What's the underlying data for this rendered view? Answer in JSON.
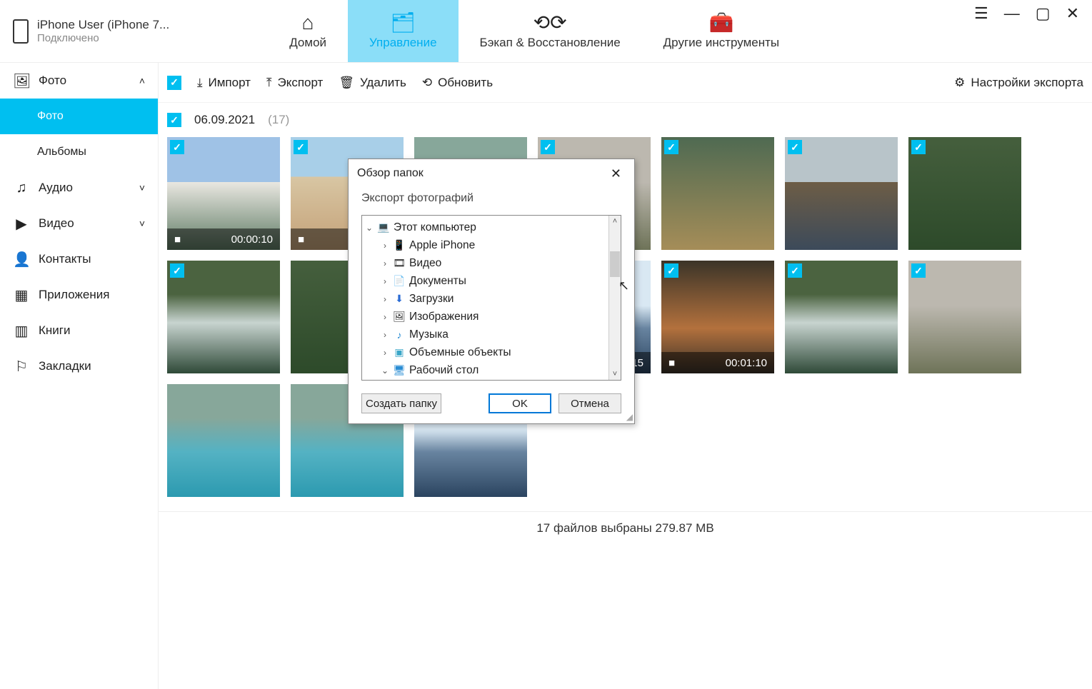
{
  "device": {
    "title": "iPhone User (iPhone 7...",
    "status": "Подключено"
  },
  "nav": {
    "home": "Домой",
    "manage": "Управление",
    "backup": "Бэкап & Восстановление",
    "tools": "Другие инструменты"
  },
  "sidebar": {
    "photo": "Фото",
    "photos": "Фото",
    "albums": "Альбомы",
    "audio": "Аудио",
    "video": "Видео",
    "contacts": "Контакты",
    "apps": "Приложения",
    "books": "Книги",
    "bookmarks": "Закладки"
  },
  "toolbar": {
    "import": "Импорт",
    "export": "Экспорт",
    "delete": "Удалить",
    "refresh": "Обновить",
    "settings": "Настройки экспорта"
  },
  "dateline": {
    "date": "06.09.2021",
    "count": "(17)"
  },
  "thumbs": {
    "t0": "00:00:10",
    "t9": "00:00:15",
    "t10": "00:01:10"
  },
  "dialog": {
    "title": "Обзор папок",
    "subtitle": "Экспорт фотографий",
    "create": "Создать папку",
    "ok": "OK",
    "cancel": "Отмена",
    "tree": {
      "computer": "Этот компьютер",
      "iphone": "Apple iPhone",
      "video": "Видео",
      "documents": "Документы",
      "downloads": "Загрузки",
      "pictures": "Изображения",
      "music": "Музыка",
      "objects3d": "Объемные объекты",
      "desktop": "Рабочий стол"
    }
  },
  "statusbar": "17 файлов выбраны 279.87 MB"
}
